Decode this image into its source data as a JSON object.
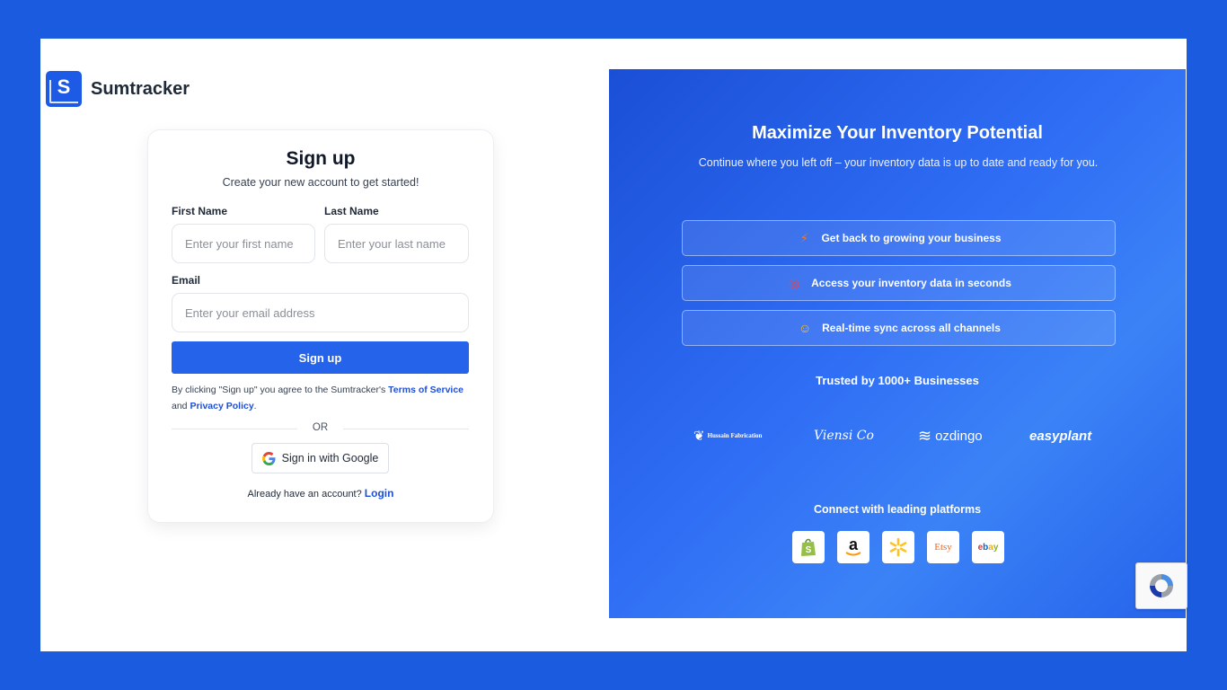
{
  "brand": {
    "logo_letter": "S",
    "name": "Sumtracker"
  },
  "signup": {
    "title": "Sign up",
    "subtitle": "Create your new account to get started!",
    "first_name_label": "First Name",
    "first_name_placeholder": "Enter your first name",
    "last_name_label": "Last Name",
    "last_name_placeholder": "Enter your last name",
    "email_label": "Email",
    "email_placeholder": "Enter your email address",
    "submit_label": "Sign up",
    "terms_prefix": "By clicking \"Sign up\" you agree to the Sumtracker's",
    "terms_link": "Terms of Service",
    "terms_and": "and",
    "privacy_link": "Privacy Policy",
    "terms_suffix": ".",
    "or_text": "OR",
    "google_label": "Sign in with Google",
    "login_prompt": "Already have an account?",
    "login_link": "Login"
  },
  "hero": {
    "title": "Maximize Your Inventory Potential",
    "subtitle": "Continue where you left off – your inventory data is up to date and ready for you.",
    "features": [
      {
        "icon": "lightning-icon",
        "label": "Get back to growing your business"
      },
      {
        "icon": "target-icon",
        "label": "Access your inventory data in seconds"
      },
      {
        "icon": "smile-icon",
        "label": "Real-time sync across all channels"
      }
    ],
    "trusted_label": "Trusted by 1000+ Businesses",
    "customer_logos": [
      "Hussain Fabrication",
      "Viensi Co",
      "ozdingo",
      "easyplant"
    ],
    "connect_label": "Connect with leading platforms",
    "platforms": [
      "Shopify",
      "Amazon",
      "Walmart",
      "Etsy",
      "ebay"
    ]
  },
  "colors": {
    "primary": "#2563eb",
    "frame_bg": "#1a5bdf",
    "link": "#1d4fd8"
  }
}
